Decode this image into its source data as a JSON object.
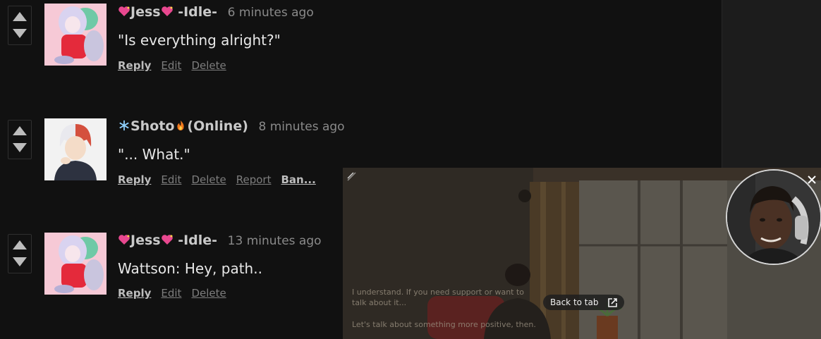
{
  "comments": [
    {
      "name": "Jess",
      "status": "-Idle-",
      "time": "6 minutes ago",
      "body": "\"Is everything alright?\"",
      "actions": [
        "Reply",
        "Edit",
        "Delete"
      ]
    },
    {
      "name": "Shoto",
      "status": "(Online)",
      "time": "8 minutes ago",
      "body": "\"... What.\"",
      "actions": [
        "Reply",
        "Edit",
        "Delete",
        "Report",
        "Ban..."
      ]
    },
    {
      "name": "Jess",
      "status": "-Idle-",
      "time": "13 minutes ago",
      "body": "Wattson: Hey, path..",
      "actions": [
        "Reply",
        "Edit",
        "Delete"
      ]
    }
  ],
  "pip": {
    "subtitle_1": "I understand. If you need support or want to",
    "subtitle_2": "talk about it...",
    "subtitle_3": "Let's talk about something more positive, then.",
    "back_to_tab": "Back to tab"
  },
  "icons": {
    "vote_up": "triangle-up-icon",
    "vote_down": "triangle-down-icon",
    "heart": "sparkling-heart-icon",
    "snowflake": "snowflake-icon",
    "fire": "fire-icon",
    "external": "open-external-icon",
    "close": "close-icon"
  },
  "colors": {
    "background": "#111111",
    "sidebar": "#1c1c1c",
    "muted": "#7d7d7d",
    "heart": "#e8488f"
  }
}
